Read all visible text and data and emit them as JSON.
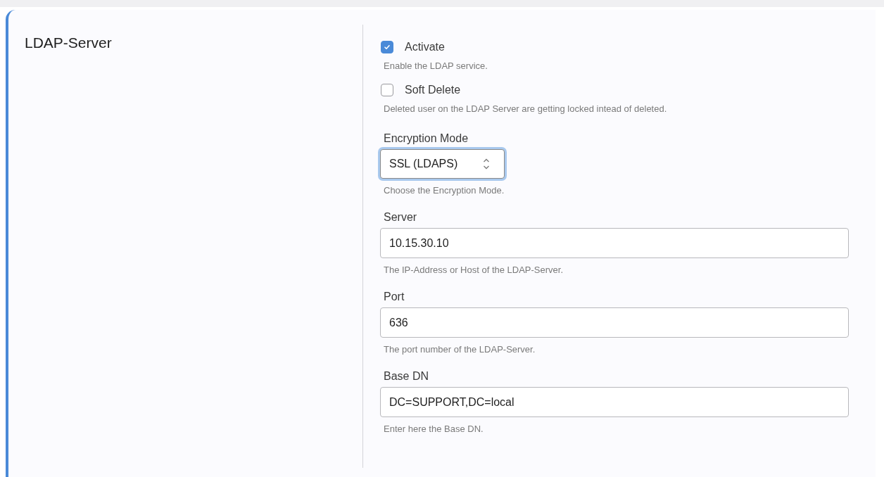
{
  "section": {
    "title": "LDAP-Server"
  },
  "fields": [
    {
      "kind": "checkbox",
      "label": "Activate",
      "checked": true,
      "help": "Enable the LDAP service."
    },
    {
      "kind": "checkbox",
      "label": "Soft Delete",
      "checked": false,
      "help": "Deleted user on the LDAP Server are getting locked intead of deleted."
    },
    {
      "kind": "select",
      "label": "Encryption Mode",
      "value": "SSL (LDAPS)",
      "focused": true,
      "help": "Choose the Encryption Mode."
    },
    {
      "kind": "text",
      "label": "Server",
      "value": "10.15.30.10",
      "help": "The IP-Address or Host of the LDAP-Server."
    },
    {
      "kind": "text",
      "label": "Port",
      "value": "636",
      "help": "The port number of the LDAP-Server."
    },
    {
      "kind": "text",
      "label": "Base DN",
      "value": "DC=SUPPORT,DC=local",
      "help": "Enter here the Base DN."
    }
  ]
}
